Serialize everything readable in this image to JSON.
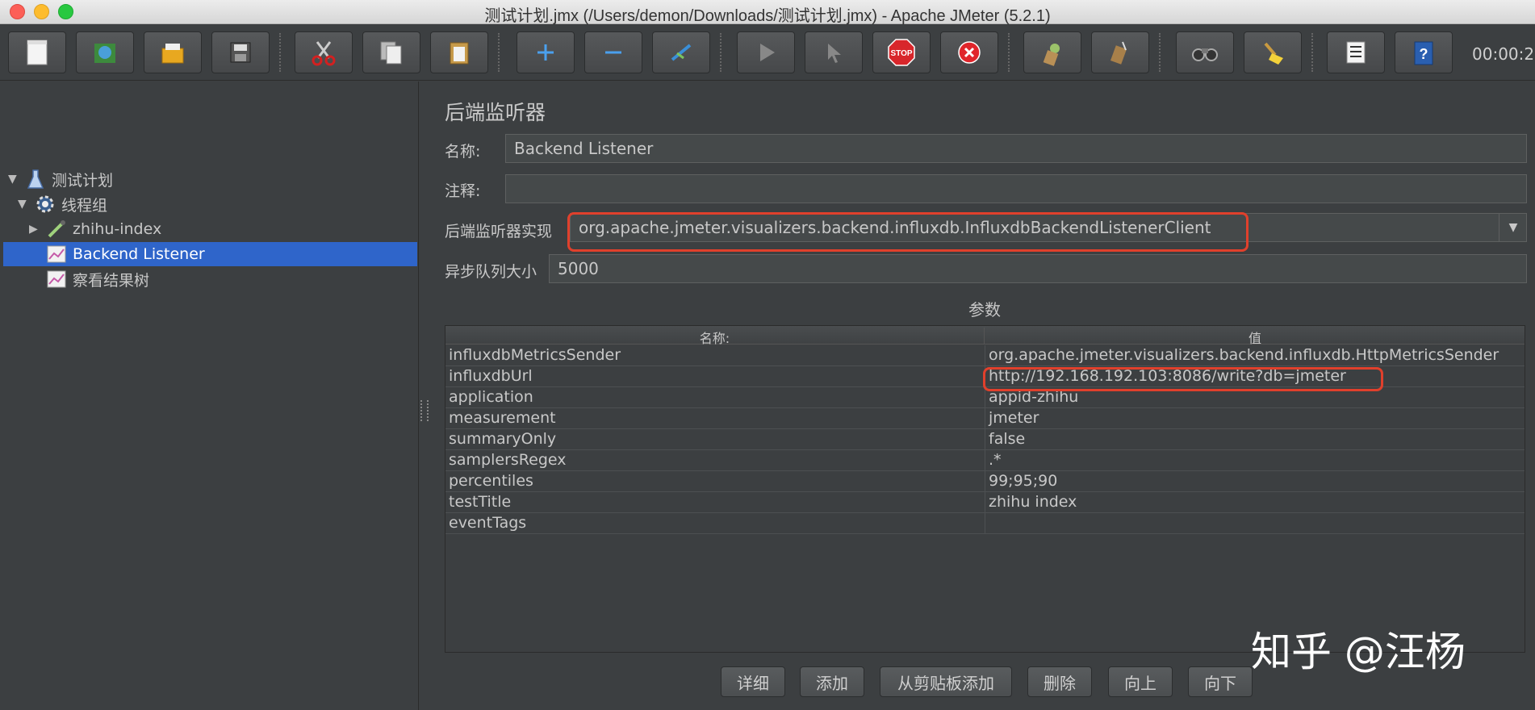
{
  "window": {
    "title": "测试计划.jmx (/Users/demon/Downloads/测试计划.jmx) - Apache JMeter (5.2.1)"
  },
  "toolbar": {
    "buttons": [
      {
        "name": "new-icon"
      },
      {
        "name": "templates-icon"
      },
      {
        "name": "open-icon"
      },
      {
        "name": "save-icon"
      },
      {
        "name": "cut-icon"
      },
      {
        "name": "copy-icon"
      },
      {
        "name": "paste-icon"
      },
      {
        "name": "expand-icon"
      },
      {
        "name": "collapse-icon"
      },
      {
        "name": "toggle-icon"
      },
      {
        "name": "start-icon"
      },
      {
        "name": "start-no-pause-icon"
      },
      {
        "name": "stop-icon"
      },
      {
        "name": "shutdown-icon"
      },
      {
        "name": "clear-icon"
      },
      {
        "name": "clear-all-icon"
      },
      {
        "name": "search-icon"
      },
      {
        "name": "reset-search-icon"
      },
      {
        "name": "function-helper-icon"
      },
      {
        "name": "help-icon"
      }
    ],
    "clock": "00:00:2"
  },
  "tree": {
    "items": [
      {
        "label": "测试计划",
        "icon": "flask-icon"
      },
      {
        "label": "线程组",
        "icon": "gear-icon"
      },
      {
        "label": "zhihu-index",
        "icon": "pipette-icon"
      },
      {
        "label": "Backend Listener",
        "icon": "graph-icon",
        "selected": true
      },
      {
        "label": "察看结果树",
        "icon": "graph-icon"
      }
    ]
  },
  "panel": {
    "heading": "后端监听器",
    "name_label": "名称:",
    "name_value": "Backend Listener",
    "comment_label": "注释:",
    "comment_value": "",
    "impl_label": "后端监听器实现",
    "impl_value": "org.apache.jmeter.visualizers.backend.influxdb.InfluxdbBackendListenerClient",
    "queue_label": "异步队列大小",
    "queue_value": "5000",
    "params_title": "参数"
  },
  "table": {
    "headers": [
      "名称:",
      "值"
    ],
    "rows": [
      [
        "influxdbMetricsSender",
        "org.apache.jmeter.visualizers.backend.influxdb.HttpMetricsSender"
      ],
      [
        "influxdbUrl",
        "http://192.168.192.103:8086/write?db=jmeter"
      ],
      [
        "application",
        "appid-zhihu"
      ],
      [
        "measurement",
        "jmeter"
      ],
      [
        "summaryOnly",
        "false"
      ],
      [
        "samplersRegex",
        ".*"
      ],
      [
        "percentiles",
        "99;95;90"
      ],
      [
        "testTitle",
        "zhihu index"
      ],
      [
        "eventTags",
        ""
      ]
    ]
  },
  "buttons": {
    "detail": "详细",
    "add": "添加",
    "add_from_clipboard": "从剪贴板添加",
    "delete": "删除",
    "up": "向上",
    "down": "向下"
  },
  "watermark": "知乎 @汪杨",
  "colors": {
    "background": "#3c3f41",
    "selection": "#2f65ca",
    "highlight": "#e0402c"
  }
}
